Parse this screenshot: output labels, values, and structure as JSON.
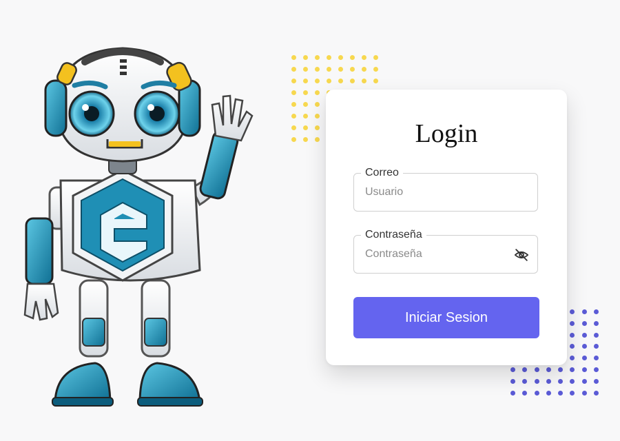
{
  "login": {
    "title": "Login",
    "email_label": "Correo",
    "email_placeholder": "Usuario",
    "email_value": "",
    "password_label": "Contraseña",
    "password_placeholder": "Contraseña",
    "password_value": "",
    "toggle_icon": "eye-off-icon",
    "submit_label": "Iniciar Sesion"
  },
  "colors": {
    "accent": "#6464ef",
    "dots_yellow": "#f7d84f",
    "dots_blue": "#5b5bd6",
    "robot_teal": "#1f8fb5"
  }
}
